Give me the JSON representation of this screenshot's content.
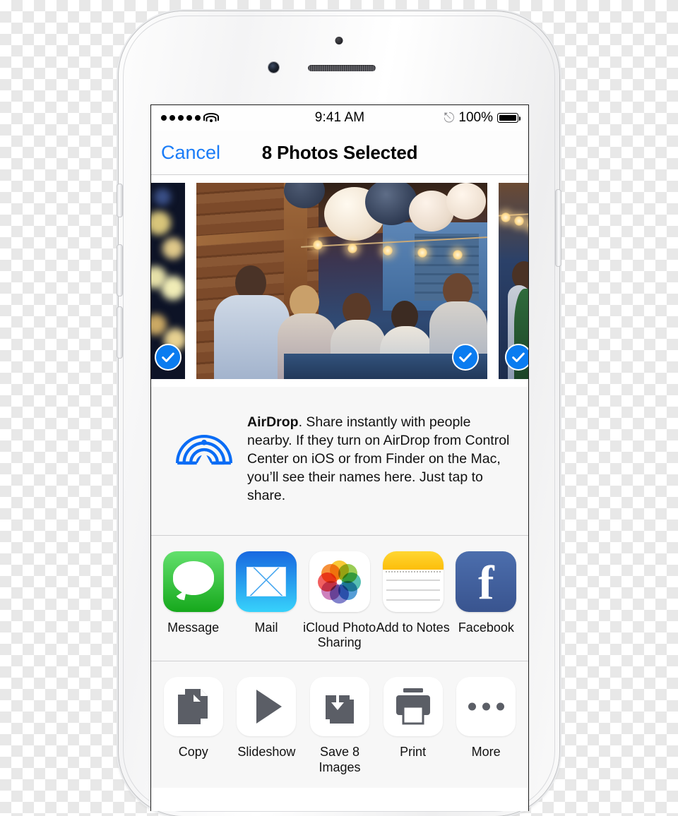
{
  "device": {
    "name": "iphone-white-silver"
  },
  "status_bar": {
    "signal_dots": 5,
    "wifi_icon": "wifi-icon",
    "time": "9:41 AM",
    "bluetooth_icon": "bluetooth-icon",
    "battery_percent": "100%",
    "battery_icon": "battery-full-icon"
  },
  "nav_bar": {
    "cancel_label": "Cancel",
    "title": "8 Photos Selected",
    "cancel_color": "#1a7cf7"
  },
  "photo_strip": {
    "thumbnails": [
      {
        "name": "photo-night-bokeh",
        "selected": true,
        "check_icon": "checkmark-circle-icon"
      },
      {
        "name": "photo-party-lanterns",
        "selected": true,
        "check_icon": "checkmark-circle-icon"
      },
      {
        "name": "photo-string-lights",
        "selected": true,
        "check_icon": "checkmark-circle-icon"
      },
      {
        "name": "photo-gold-star",
        "selected": true,
        "check_icon": "checkmark-circle-icon"
      }
    ],
    "check_color": "#0a7cf0"
  },
  "airdrop": {
    "icon": "airdrop-icon",
    "icon_color": "#0a6cf5",
    "title": "AirDrop",
    "body": ". Share instantly with people nearby. If they turn on AirDrop from Control Center on iOS or from Finder on the Mac, you’ll see their names here. Just tap to share."
  },
  "share_apps": [
    {
      "label": "Message",
      "icon": "messages-icon"
    },
    {
      "label": "Mail",
      "icon": "mail-icon"
    },
    {
      "label": "iCloud Photo Sharing",
      "icon": "photos-icon"
    },
    {
      "label": "Add to Notes",
      "icon": "notes-icon"
    },
    {
      "label": "Facebook",
      "icon": "facebook-icon"
    }
  ],
  "actions": [
    {
      "label": "Copy",
      "icon": "copy-icon"
    },
    {
      "label": "Slideshow",
      "icon": "play-icon"
    },
    {
      "label": "Save 8 Images",
      "icon": "save-download-icon"
    },
    {
      "label": "Print",
      "icon": "printer-icon"
    },
    {
      "label": "More",
      "icon": "ellipsis-icon"
    }
  ]
}
